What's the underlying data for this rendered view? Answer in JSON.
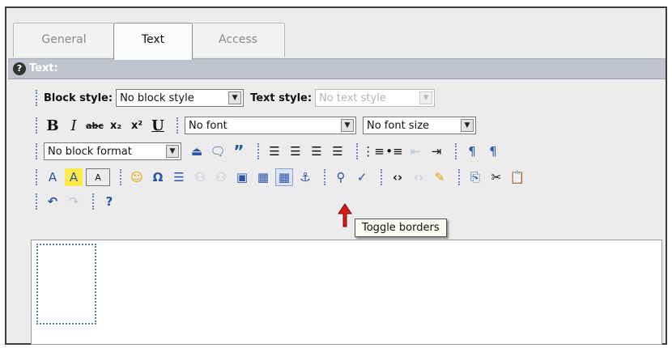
{
  "tabs": [
    {
      "label": "General",
      "active": false
    },
    {
      "label": "Text",
      "active": true
    },
    {
      "label": "Access",
      "active": false
    }
  ],
  "header": {
    "title": "Text:",
    "help_icon_text": "?"
  },
  "toolbar": {
    "row1": {
      "block_style_label": "Block style:",
      "block_style_value": "No block style",
      "text_style_label": "Text style:",
      "text_style_value": "No text style"
    },
    "row2": {
      "bold": "B",
      "italic": "I",
      "strike": "abc",
      "subscript": "x₂",
      "superscript": "x²",
      "underline": "U",
      "font_value": "No font",
      "font_size_value": "No font size"
    },
    "row3": {
      "block_format_value": "No block format"
    },
    "tooltip": "Toggle borders"
  },
  "colors": {
    "header_bar": "#bfc3cd",
    "frame_bg": "#ececec",
    "accent_blue": "#2d55a6"
  }
}
